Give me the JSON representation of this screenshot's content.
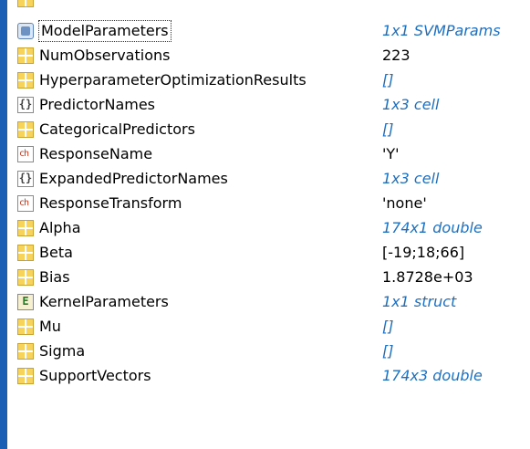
{
  "workspace": {
    "variables": [
      {
        "name": "ModelParameters",
        "value": "1x1 SVMParams",
        "icon": "object-icon",
        "value_style": "desc"
      },
      {
        "name": "NumObservations",
        "value": "223",
        "icon": "matrix-icon",
        "value_style": "plain"
      },
      {
        "name": "HyperparameterOptimizationResults",
        "value": "[]",
        "icon": "matrix-icon",
        "value_style": "desc"
      },
      {
        "name": "PredictorNames",
        "value": "1x3 cell",
        "icon": "cell-array-icon",
        "value_style": "desc"
      },
      {
        "name": "CategoricalPredictors",
        "value": "[]",
        "icon": "matrix-icon",
        "value_style": "desc"
      },
      {
        "name": "ResponseName",
        "value": "'Y'",
        "icon": "char-icon",
        "value_style": "plain"
      },
      {
        "name": "ExpandedPredictorNames",
        "value": "1x3 cell",
        "icon": "cell-array-icon",
        "value_style": "desc"
      },
      {
        "name": "ResponseTransform",
        "value": "'none'",
        "icon": "char-icon",
        "value_style": "plain"
      },
      {
        "name": "Alpha",
        "value": "174x1 double",
        "icon": "matrix-icon",
        "value_style": "desc"
      },
      {
        "name": "Beta",
        "value": "[-19;18;66]",
        "icon": "matrix-icon",
        "value_style": "plain"
      },
      {
        "name": "Bias",
        "value": "1.8728e+03",
        "icon": "matrix-icon",
        "value_style": "plain"
      },
      {
        "name": "KernelParameters",
        "value": "1x1 struct",
        "icon": "struct-icon",
        "value_style": "desc"
      },
      {
        "name": "Mu",
        "value": "[]",
        "icon": "matrix-icon",
        "value_style": "desc"
      },
      {
        "name": "Sigma",
        "value": "[]",
        "icon": "matrix-icon",
        "value_style": "desc"
      },
      {
        "name": "SupportVectors",
        "value": "174x3 double",
        "icon": "matrix-icon",
        "value_style": "desc"
      }
    ]
  },
  "icon_glyphs": {
    "cell": "{}",
    "char": "ch",
    "struct": "E"
  },
  "colors": {
    "accent_bar": "#1a5fb4",
    "description_value": "#1f6fbf",
    "matrix_icon": "#f7d35c"
  }
}
